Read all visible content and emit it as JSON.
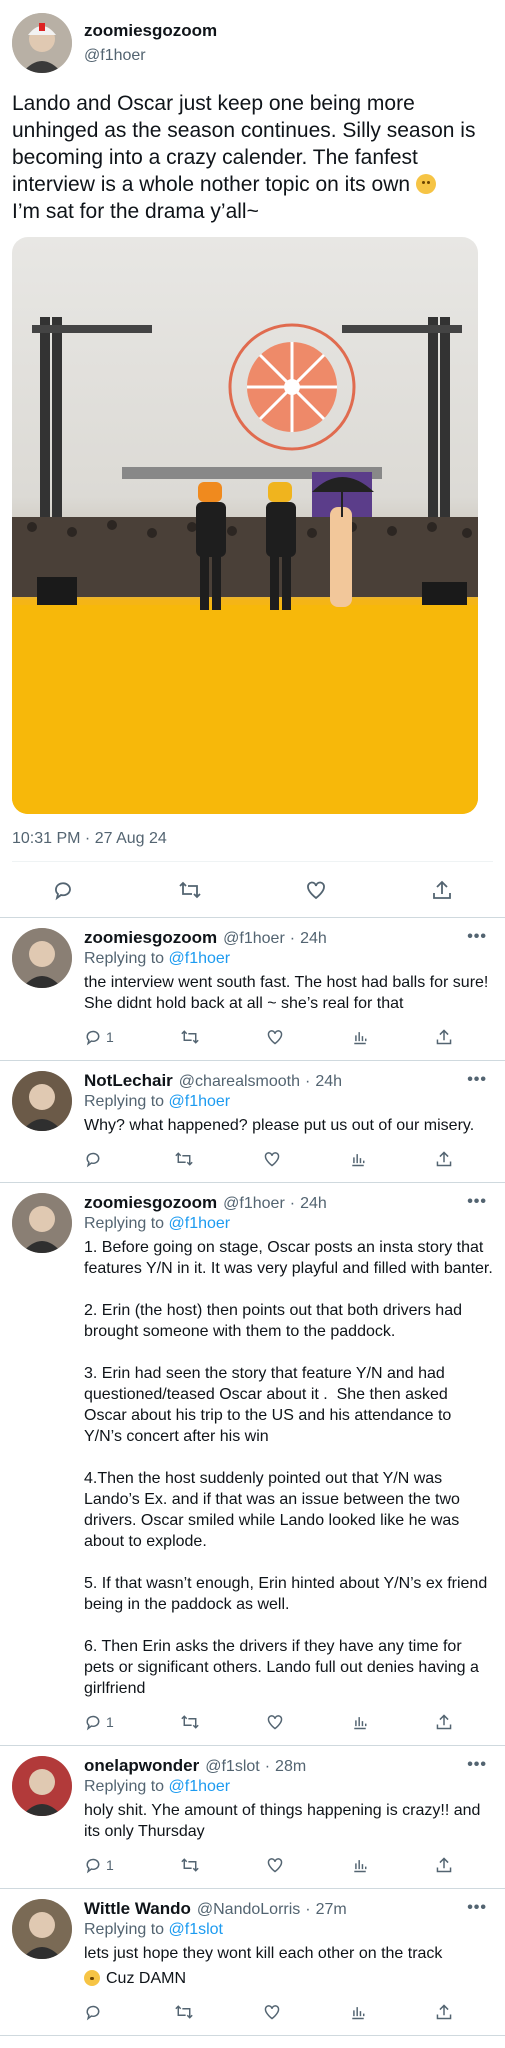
{
  "main": {
    "name": "zoomiesgozoom",
    "handle": "@f1hoer",
    "text": "Lando and Oscar just keep one being more unhinged as the season continues. Silly season is becoming into a crazy calender. The fanfest interview is a whole nother topic on its own",
    "text_after_emoji": "I’m sat for the drama y’all~",
    "timestamp": "10:31 PM · 27 Aug 24",
    "photo_icon": "concert-stage-photo"
  },
  "replies": [
    {
      "name": "zoomiesgozoom",
      "handle": "@f1hoer",
      "time": "24h",
      "replying_label": "Replying to",
      "replying_to": "@f1hoer",
      "text": "the interview went south fast. The host had balls for sure!  She didnt hold back at all ~ she’s real for that",
      "reply_count": "1",
      "avatar_color": "#8a7f74"
    },
    {
      "name": "NotLechair",
      "handle": "@charealsmooth",
      "time": "24h",
      "replying_label": "Replying to",
      "replying_to": "@f1hoer",
      "text": "Why? what happened? please put us out of our misery.",
      "reply_count": "",
      "avatar_color": "#6b5a48"
    },
    {
      "name": "zoomiesgozoom",
      "handle": "@f1hoer",
      "time": "24h",
      "replying_label": "Replying to",
      "replying_to": "@f1hoer",
      "text": "1. Before going on stage, Oscar posts an insta story that features Y/N in it. It was very playful and filled with banter.\n\n2. Erin (the host) then points out that both drivers had brought someone with them to the paddock.\n\n3. Erin had seen the story that feature Y/N and had questioned/teased Oscar about it .  She then asked Oscar about his trip to the US and his attendance to Y/N’s concert after his win\n\n4.Then the host suddenly pointed out that Y/N was Lando’s Ex. and if that was an issue between the two drivers. Oscar smiled while Lando looked like he was about to explode.\n\n5. If that wasn’t enough, Erin hinted about Y/N’s ex friend being in the paddock as well.\n\n6. Then Erin asks the drivers if they have any time for pets or significant others. Lando full out denies having a girlfriend",
      "reply_count": "1",
      "avatar_color": "#8a7f74"
    },
    {
      "name": "onelapwonder",
      "handle": "@f1slot",
      "time": "28m",
      "replying_label": "Replying to",
      "replying_to": "@f1hoer",
      "text": "holy shit. Yhe amount of things happening is crazy!! and its only Thursday",
      "reply_count": "1",
      "avatar_color": "#b23a3a"
    },
    {
      "name": "Wittle Wando",
      "handle": "@NandoLorris",
      "time": "27m",
      "replying_label": "Replying to",
      "replying_to": "@f1slot",
      "text": "lets just hope they wont kill each other on the track",
      "text_line2": "Cuz DAMN",
      "reply_count": "",
      "avatar_color": "#7a6a55"
    }
  ],
  "more_icon_label": "•••"
}
